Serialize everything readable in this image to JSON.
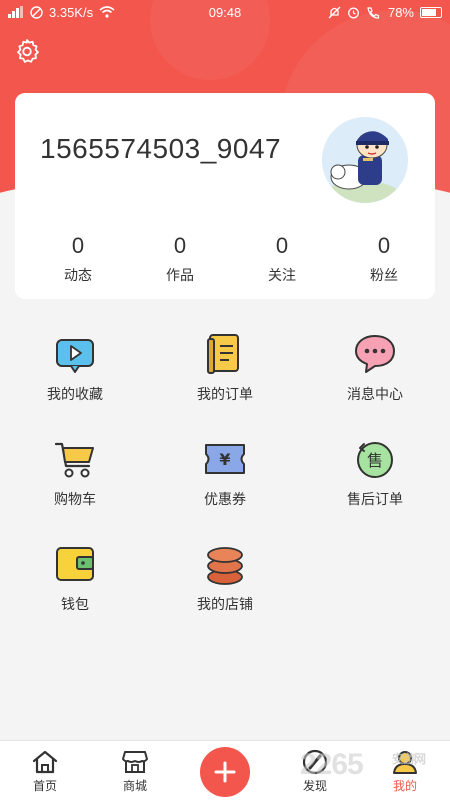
{
  "status_bar": {
    "speed": "3.35K/s",
    "time": "09:48",
    "battery": "78%"
  },
  "header": {
    "settings_icon": "gear-icon"
  },
  "profile": {
    "username": "1565574503_9047",
    "stats": [
      {
        "value": "0",
        "label": "动态"
      },
      {
        "value": "0",
        "label": "作品"
      },
      {
        "value": "0",
        "label": "关注"
      },
      {
        "value": "0",
        "label": "粉丝"
      }
    ]
  },
  "menu": [
    {
      "label": "我的收藏",
      "icon": "video-favorite-icon"
    },
    {
      "label": "我的订单",
      "icon": "order-list-icon"
    },
    {
      "label": "消息中心",
      "icon": "message-bubble-icon"
    },
    {
      "label": "购物车",
      "icon": "shopping-cart-icon"
    },
    {
      "label": "优惠券",
      "icon": "coupon-icon"
    },
    {
      "label": "售后订单",
      "icon": "after-sales-icon"
    },
    {
      "label": "钱包",
      "icon": "wallet-icon"
    },
    {
      "label": "我的店铺",
      "icon": "store-coins-icon"
    }
  ],
  "bottom_nav": [
    {
      "label": "首页",
      "icon": "home-icon"
    },
    {
      "label": "商城",
      "icon": "shop-icon"
    },
    {
      "label": "",
      "icon": "add-icon"
    },
    {
      "label": "发现",
      "icon": "compass-icon"
    },
    {
      "label": "我的",
      "icon": "user-icon",
      "active": true
    }
  ],
  "watermark": {
    "text": "2265",
    "suffix": "安游网"
  },
  "colors": {
    "accent": "#f2564c",
    "background": "#f4f4f4"
  }
}
